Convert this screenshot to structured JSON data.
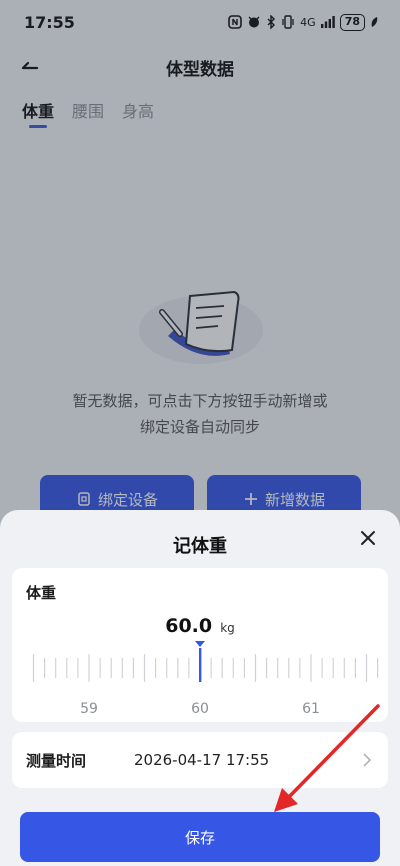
{
  "status_bar": {
    "time": "17:55",
    "network": "4G",
    "battery": "78"
  },
  "nav": {
    "title": "体型数据"
  },
  "tabs": [
    {
      "label": "体重",
      "active": true
    },
    {
      "label": "腰围",
      "active": false
    },
    {
      "label": "身高",
      "active": false
    }
  ],
  "empty_state": {
    "line1": "暂无数据，可点击下方按钮手动新增或",
    "line2": "绑定设备自动同步"
  },
  "actions": {
    "bind_device": "绑定设备",
    "add_data": "新增数据"
  },
  "sheet": {
    "title": "记体重",
    "weight_label": "体重",
    "weight_value": "60.0",
    "weight_unit": "kg",
    "ruler": {
      "min": 58.5,
      "max": 61.7,
      "step": 0.1,
      "selected": 60.0,
      "labels": [
        "59",
        "60",
        "61"
      ]
    },
    "time_label": "测量时间",
    "time_value": "2026-04-17 17:55",
    "save_label": "保存"
  },
  "colors": {
    "accent": "#3656e6",
    "annotation_arrow": "#e32626"
  }
}
